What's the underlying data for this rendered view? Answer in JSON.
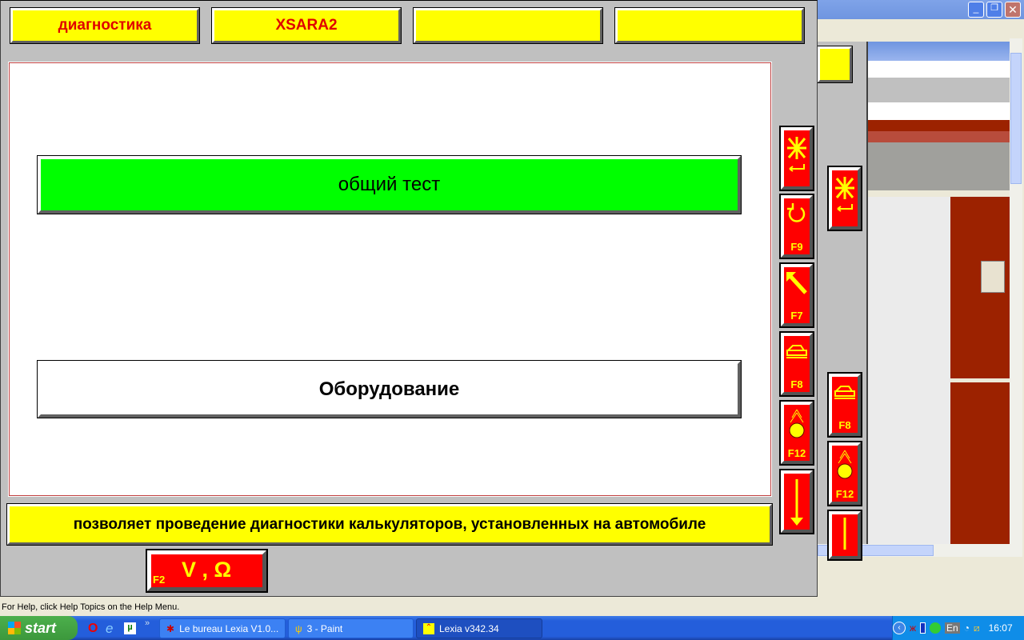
{
  "lexia": {
    "top_buttons": [
      "диагностика",
      "XSARA2",
      "",
      ""
    ],
    "menu_items": [
      {
        "label": "общий тест",
        "color": "#00ff00"
      },
      {
        "label": "Оборудование",
        "color": "#ffffff"
      }
    ],
    "side_buttons": [
      {
        "icon": "cancel-enter-icon",
        "key": ""
      },
      {
        "icon": "undo-icon",
        "key": "F9"
      },
      {
        "icon": "arrow-up-left-icon",
        "key": "F7"
      },
      {
        "icon": "print-icon",
        "key": "F8"
      },
      {
        "icon": "globe-signal-icon",
        "key": "F12"
      },
      {
        "icon": "arrow-down-icon",
        "key": ""
      }
    ],
    "description": "позволяет проведение диагностики калькуляторов, установленных на автомобиле",
    "measure_button": {
      "key": "F2",
      "label": "V , Ω"
    }
  },
  "background_window": {
    "side_buttons": [
      {
        "key": ""
      },
      {
        "key": "F8"
      },
      {
        "key": "F12"
      }
    ]
  },
  "status_bar": "For Help, click Help Topics on the Help Menu.",
  "taskbar": {
    "start": "start",
    "tasks": [
      "Le bureau Lexia V1.0...",
      "3 - Paint",
      "Lexia v342.34"
    ],
    "language": "En",
    "clock": "16:07"
  },
  "colors": {
    "yellow": "#ffff00",
    "red": "#ff0000",
    "green": "#00ff00",
    "panel": "#c0c0c0"
  }
}
